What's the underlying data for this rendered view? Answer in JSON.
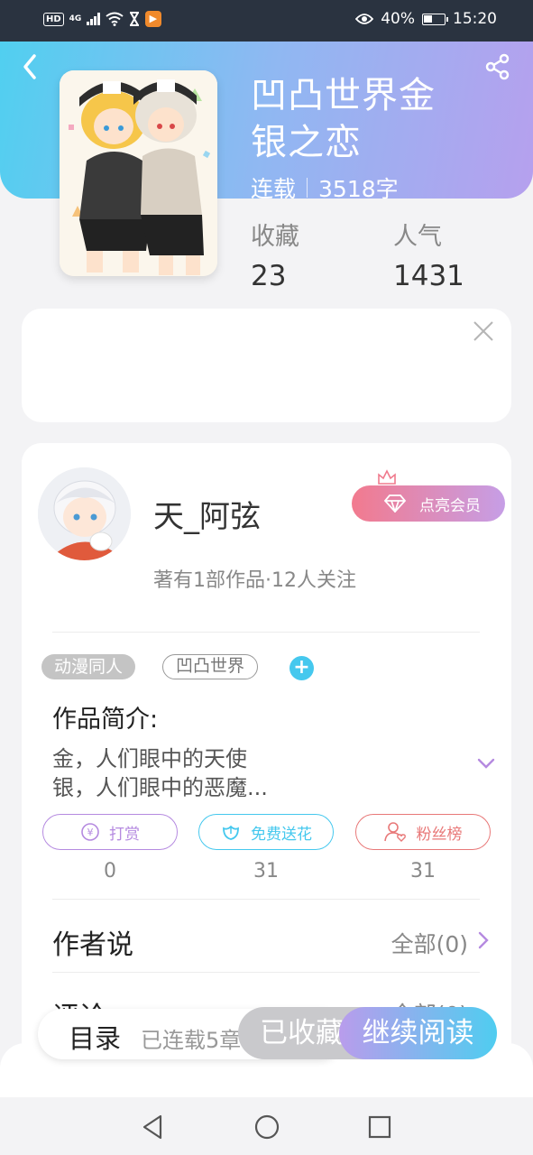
{
  "status_bar": {
    "hd": "HD",
    "network": "4G",
    "battery": "40%",
    "time": "15:20"
  },
  "book": {
    "title_line1": "凹凸世界金",
    "title_line2": "银之恋",
    "status": "连载",
    "word_count": "3518字",
    "favorites_label": "收藏",
    "favorites_value": "23",
    "popularity_label": "人气",
    "popularity_value": "1431"
  },
  "author": {
    "name": "天_阿弦",
    "stats": "著有1部作品·12人关注",
    "vip_label": "点亮会员"
  },
  "tags": [
    "动漫同人",
    "凹凸世界"
  ],
  "intro": {
    "heading": "作品简介:",
    "line1": "金，人们眼中的天使",
    "line2": "银，人们眼中的恶魔..."
  },
  "actions": [
    {
      "label": "打赏",
      "count": "0"
    },
    {
      "label": "免费送花",
      "count": "31"
    },
    {
      "label": "粉丝榜",
      "count": "31"
    }
  ],
  "author_says": {
    "label": "作者说",
    "value": "全部(0)"
  },
  "comments": {
    "label": "评论",
    "value": "全部(0)"
  },
  "bottom": {
    "toc_label": "目录",
    "toc_sub": "已连载5章",
    "favorite_label": "已收藏",
    "read_label": "继续阅读"
  },
  "colors": {
    "header_start": "#4fd0f0",
    "header_end": "#b6a0ee",
    "reward": "#b58ae0",
    "flower": "#45c8ee",
    "fans": "#e87878"
  }
}
